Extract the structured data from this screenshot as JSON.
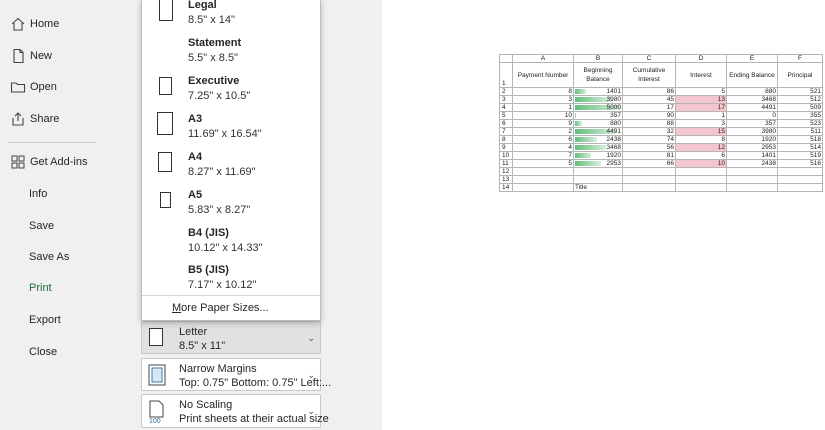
{
  "nav": {
    "items": [
      {
        "label": "Home",
        "icon": "home-icon"
      },
      {
        "label": "New",
        "icon": "new-file-icon"
      },
      {
        "label": "Open",
        "icon": "folder-icon"
      },
      {
        "label": "Share",
        "icon": "share-icon"
      },
      {
        "label": "Get Add-ins",
        "icon": "add-ins-icon"
      },
      {
        "label": "Info"
      },
      {
        "label": "Save"
      },
      {
        "label": "Save As"
      },
      {
        "label": "Print",
        "active": true
      },
      {
        "label": "Export"
      },
      {
        "label": "Close"
      }
    ]
  },
  "paper_dropdown": {
    "items": [
      {
        "name": "Legal",
        "dims": "8.5\" x 14\""
      },
      {
        "name": "Statement",
        "dims": "5.5\" x 8.5\""
      },
      {
        "name": "Executive",
        "dims": "7.25\" x 10.5\""
      },
      {
        "name": "A3",
        "dims": "11.69\" x 16.54\""
      },
      {
        "name": "A4",
        "dims": "8.27\" x 11.69\""
      },
      {
        "name": "A5",
        "dims": "5.83\" x 8.27\""
      },
      {
        "name": "B4 (JIS)",
        "dims": "10.12\" x 14.33\""
      },
      {
        "name": "B5 (JIS)",
        "dims": "7.17\" x 10.12\""
      }
    ],
    "more_label_accel": "M",
    "more_label_rest": "ore Paper Sizes..."
  },
  "settings": {
    "paper": {
      "title": "Letter",
      "sub": "8.5\" x 11\""
    },
    "margins": {
      "title": "Narrow Margins",
      "sub": "Top: 0.75\" Bottom: 0.75\" Left:..."
    },
    "scaling": {
      "title": "No Scaling",
      "sub": "Print sheets at their actual size",
      "icon_text": "100"
    }
  },
  "sheet": {
    "columns": [
      "A",
      "B",
      "C",
      "D",
      "E",
      "F"
    ],
    "headers": [
      "Payment Number",
      "Beginning Balance",
      "Cumulative Interest",
      "Interest",
      "Ending Balance",
      "Principal"
    ],
    "rows": [
      {
        "n": "2",
        "a": "8",
        "b": "1401",
        "c": "86",
        "d": "5",
        "e": "880",
        "f": "521",
        "bfill": 0.28,
        "dpink": false
      },
      {
        "n": "3",
        "a": "3",
        "b": "3980",
        "c": "45",
        "d": "13",
        "e": "3468",
        "f": "512",
        "bfill": 0.8,
        "dpink": true
      },
      {
        "n": "4",
        "a": "1",
        "b": "5000",
        "c": "17",
        "d": "17",
        "e": "4491",
        "f": "509",
        "bfill": 1.0,
        "dpink": true
      },
      {
        "n": "5",
        "a": "10",
        "b": "357",
        "c": "90",
        "d": "1",
        "e": "0",
        "f": "355",
        "bfill": 0.07,
        "dpink": false
      },
      {
        "n": "6",
        "a": "9",
        "b": "880",
        "c": "88",
        "d": "3",
        "e": "357",
        "f": "523",
        "bfill": 0.18,
        "dpink": false
      },
      {
        "n": "7",
        "a": "2",
        "b": "4491",
        "c": "32",
        "d": "15",
        "e": "3980",
        "f": "511",
        "bfill": 0.9,
        "dpink": true
      },
      {
        "n": "8",
        "a": "6",
        "b": "2438",
        "c": "74",
        "d": "8",
        "e": "1920",
        "f": "518",
        "bfill": 0.49,
        "dpink": false
      },
      {
        "n": "9",
        "a": "4",
        "b": "3468",
        "c": "56",
        "d": "12",
        "e": "2953",
        "f": "514",
        "bfill": 0.69,
        "dpink": true
      },
      {
        "n": "10",
        "a": "7",
        "b": "1920",
        "c": "81",
        "d": "6",
        "e": "1401",
        "f": "519",
        "bfill": 0.38,
        "dpink": false
      },
      {
        "n": "11",
        "a": "5",
        "b": "2953",
        "c": "66",
        "d": "10",
        "e": "2438",
        "f": "516",
        "bfill": 0.59,
        "dpink": true
      }
    ],
    "empty_rows": [
      "12",
      "13"
    ],
    "last_row": {
      "n": "14",
      "b": "Title"
    },
    "header_row_num": "1"
  }
}
